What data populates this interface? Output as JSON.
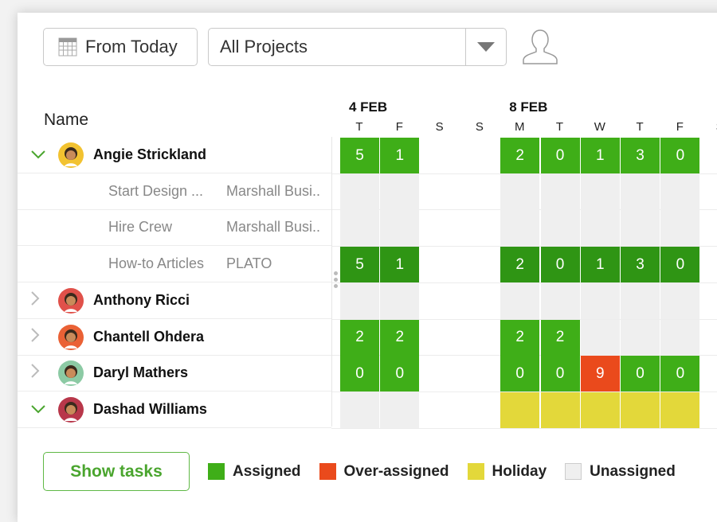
{
  "toolbar": {
    "from_today": "From Today",
    "project_filter": "All Projects"
  },
  "header": {
    "name": "Name",
    "dates": [
      {
        "label": "4 FEB",
        "col": 0
      },
      {
        "label": "8 FEB",
        "col": 4
      }
    ],
    "days": [
      "T",
      "F",
      "S",
      "S",
      "M",
      "T",
      "W",
      "T",
      "F",
      "S"
    ]
  },
  "colors": {
    "assigned": "#3fae18",
    "task": "#2f9514",
    "over": "#ea4a1c",
    "holiday": "#e3d83a",
    "unassigned": "#efefef"
  },
  "rows": [
    {
      "type": "person",
      "name": "Angie Strickland",
      "expanded": true,
      "avatar": "#f2c230",
      "cells": [
        [
          "assigned",
          "5"
        ],
        [
          "assigned",
          "1"
        ],
        null,
        null,
        [
          "assigned",
          "2"
        ],
        [
          "assigned",
          "0"
        ],
        [
          "assigned",
          "1"
        ],
        [
          "assigned",
          "3"
        ],
        [
          "assigned",
          "0"
        ]
      ]
    },
    {
      "type": "task",
      "name": "Start Design ...",
      "project": "Marshall Busi..",
      "cells": [
        [
          "unassigned",
          ""
        ],
        [
          "unassigned",
          ""
        ],
        null,
        null,
        [
          "unassigned",
          ""
        ],
        [
          "unassigned",
          ""
        ],
        [
          "unassigned",
          ""
        ],
        [
          "unassigned",
          ""
        ],
        [
          "unassigned",
          ""
        ]
      ]
    },
    {
      "type": "task",
      "name": "Hire Crew",
      "project": "Marshall Busi..",
      "cells": [
        [
          "unassigned",
          ""
        ],
        [
          "unassigned",
          ""
        ],
        null,
        null,
        [
          "unassigned",
          ""
        ],
        [
          "unassigned",
          ""
        ],
        [
          "unassigned",
          ""
        ],
        [
          "unassigned",
          ""
        ],
        [
          "unassigned",
          ""
        ]
      ]
    },
    {
      "type": "task",
      "name": "How-to Articles",
      "project": "PLATO",
      "cells": [
        [
          "task",
          "5"
        ],
        [
          "task",
          "1"
        ],
        null,
        null,
        [
          "task",
          "2"
        ],
        [
          "task",
          "0"
        ],
        [
          "task",
          "1"
        ],
        [
          "task",
          "3"
        ],
        [
          "task",
          "0"
        ]
      ]
    },
    {
      "type": "person",
      "name": "Anthony Ricci",
      "expanded": false,
      "avatar": "#e0514a",
      "cells": [
        [
          "unassigned",
          ""
        ],
        [
          "unassigned",
          ""
        ],
        null,
        null,
        [
          "unassigned",
          ""
        ],
        [
          "unassigned",
          ""
        ],
        [
          "unassigned",
          ""
        ],
        [
          "unassigned",
          ""
        ],
        [
          "unassigned",
          ""
        ]
      ]
    },
    {
      "type": "person",
      "name": "Chantell Ohdera",
      "expanded": false,
      "avatar": "#ea6135",
      "cells": [
        [
          "assigned",
          "2"
        ],
        [
          "assigned",
          "2"
        ],
        null,
        null,
        [
          "assigned",
          "2"
        ],
        [
          "assigned",
          "2"
        ],
        [
          "unassigned",
          ""
        ],
        [
          "unassigned",
          ""
        ],
        [
          "unassigned",
          ""
        ]
      ]
    },
    {
      "type": "person",
      "name": "Daryl Mathers",
      "expanded": false,
      "avatar": "#8ccaa4",
      "cells": [
        [
          "assigned",
          "0"
        ],
        [
          "assigned",
          "0"
        ],
        null,
        null,
        [
          "assigned",
          "0"
        ],
        [
          "assigned",
          "0"
        ],
        [
          "over",
          "9"
        ],
        [
          "assigned",
          "0"
        ],
        [
          "assigned",
          "0"
        ]
      ]
    },
    {
      "type": "person",
      "name": "Dashad Williams",
      "expanded": true,
      "avatar": "#b8374a",
      "cells": [
        [
          "unassigned",
          ""
        ],
        [
          "unassigned",
          ""
        ],
        null,
        null,
        [
          "holiday",
          ""
        ],
        [
          "holiday",
          ""
        ],
        [
          "holiday",
          ""
        ],
        [
          "holiday",
          ""
        ],
        [
          "holiday",
          ""
        ]
      ]
    }
  ],
  "legend": {
    "show_tasks": "Show tasks",
    "items": [
      {
        "label": "Assigned",
        "color": "#3fae18"
      },
      {
        "label": "Over-assigned",
        "color": "#ea4a1c"
      },
      {
        "label": "Holiday",
        "color": "#e3d83a"
      },
      {
        "label": "Unassigned",
        "color": "#efefef"
      }
    ]
  }
}
